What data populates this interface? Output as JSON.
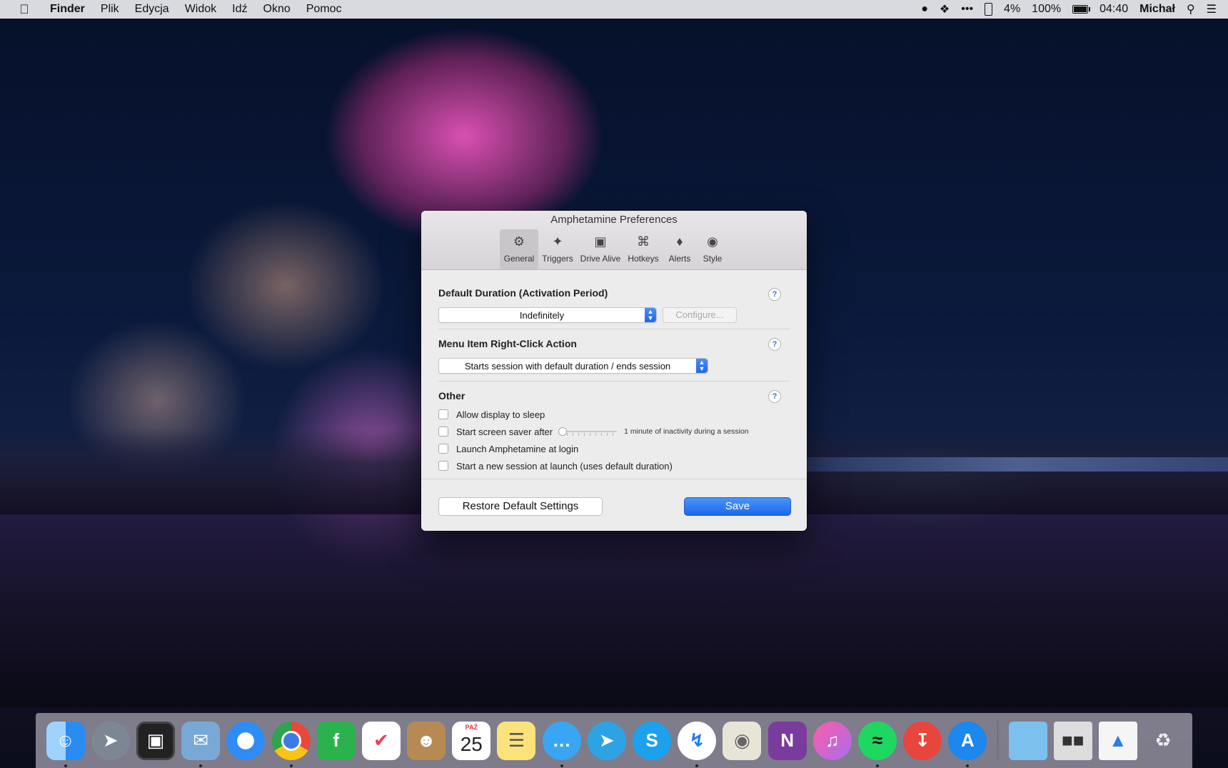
{
  "menubar": {
    "app_name": "Finder",
    "items": [
      "Plik",
      "Edycja",
      "Widok",
      "Idź",
      "Okno",
      "Pomoc"
    ],
    "status": {
      "dots": "•••",
      "phone_battery": "4%",
      "battery": "100%",
      "time": "04:40",
      "user": "Michał"
    }
  },
  "window": {
    "title": "Amphetamine Preferences",
    "tabs": [
      {
        "label": "General",
        "icon": "gear-icon"
      },
      {
        "label": "Triggers",
        "icon": "magic-wand-icon"
      },
      {
        "label": "Drive Alive",
        "icon": "drive-icon"
      },
      {
        "label": "Hotkeys",
        "icon": "command-icon"
      },
      {
        "label": "Alerts",
        "icon": "bell-icon"
      },
      {
        "label": "Style",
        "icon": "eye-icon"
      }
    ],
    "active_tab": "General",
    "default_duration": {
      "title": "Default Duration (Activation Period)",
      "selected": "Indefinitely",
      "configure_label": "Configure..."
    },
    "right_click": {
      "title": "Menu Item Right-Click Action",
      "selected": "Starts session with default duration / ends session"
    },
    "other": {
      "title": "Other",
      "allow_sleep": "Allow display to sleep",
      "screen_saver": "Start screen saver after",
      "screen_saver_value": "1 minute of inactivity during a session",
      "launch_login": "Launch Amphetamine at login",
      "new_session": "Start a new session at launch (uses default duration)"
    },
    "help_glyph": "?",
    "restore_label": "Restore Default Settings",
    "save_label": "Save"
  },
  "dock": {
    "calendar_month": "PAŹ",
    "calendar_day": "25",
    "apps": [
      "Finder",
      "Launchpad",
      "Photo Booth",
      "Preview",
      "Safari",
      "Chrome",
      "Feedly",
      "Pocket",
      "Contacts",
      "Calendar",
      "Notes",
      "Messages",
      "Telegram",
      "Skype",
      "Messenger",
      "Photos",
      "OneNote",
      "iTunes",
      "Spotify",
      "Transmit",
      "App Store"
    ]
  },
  "colors": {
    "accent": "#1d68ea",
    "menubar_bg": "#ebebf0",
    "window_bg": "#ececec"
  }
}
